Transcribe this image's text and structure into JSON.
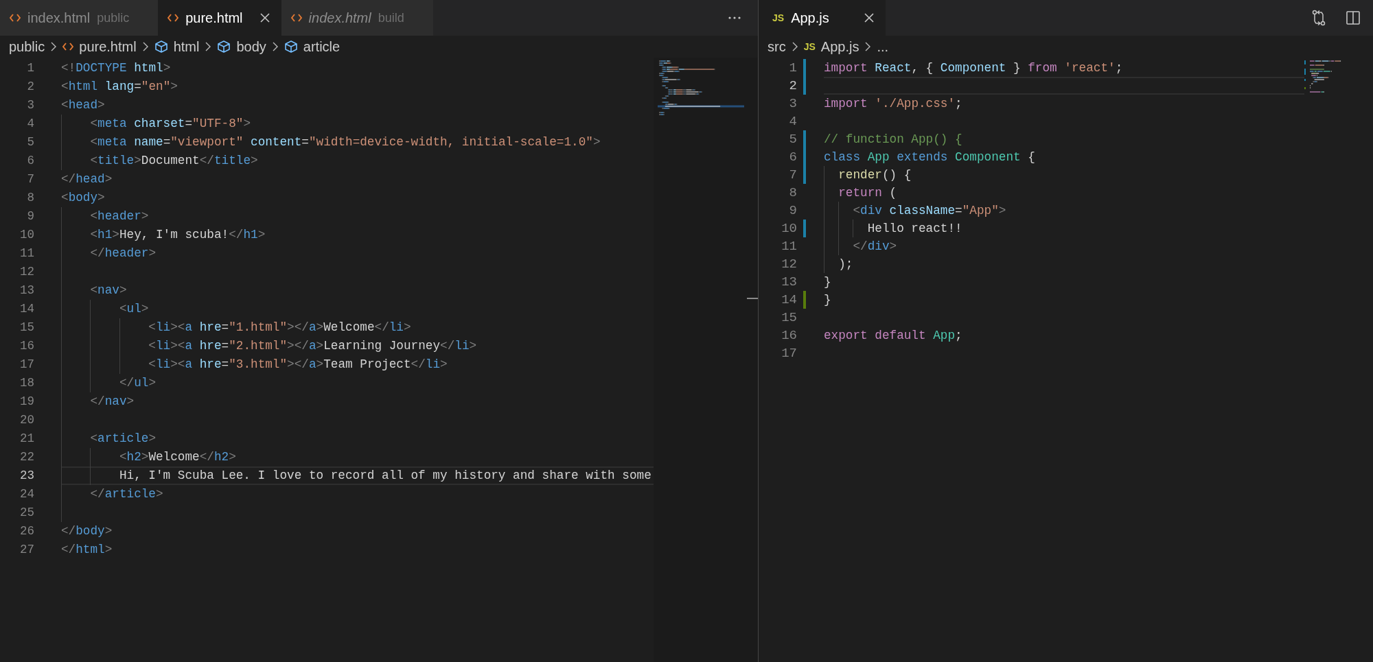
{
  "editors": [
    {
      "tabs": [
        {
          "kind": "html",
          "label": "index.html",
          "description": "public",
          "selected": false,
          "preview": false
        },
        {
          "kind": "html",
          "label": "pure.html",
          "selected": true,
          "preview": false
        },
        {
          "kind": "html",
          "label": "index.html",
          "description": "build",
          "selected": false,
          "preview": true
        }
      ],
      "breadcrumbs": [
        {
          "kind": "folder",
          "label": "public"
        },
        {
          "kind": "html",
          "label": "pure.html"
        },
        {
          "kind": "element",
          "label": "html"
        },
        {
          "kind": "element",
          "label": "body"
        },
        {
          "kind": "element",
          "label": "article"
        }
      ],
      "lines": [
        {
          "number": "1",
          "current": false,
          "tokens": [
            {
              "kind": "punct",
              "text": "<!"
            },
            {
              "kind": "tag",
              "text": "DOCTYPE"
            },
            {
              "kind": "attr",
              "text": " html"
            },
            {
              "kind": "punct",
              "text": ">"
            }
          ]
        },
        {
          "number": "2",
          "current": false,
          "tokens": [
            {
              "kind": "punct",
              "text": "<"
            },
            {
              "kind": "tag",
              "text": "html"
            },
            {
              "kind": "attr",
              "text": " lang"
            },
            {
              "kind": "text",
              "text": "="
            },
            {
              "kind": "string",
              "text": "\"en\""
            },
            {
              "kind": "punct",
              "text": ">"
            }
          ]
        },
        {
          "number": "3",
          "current": false,
          "tokens": [
            {
              "kind": "punct",
              "text": "<"
            },
            {
              "kind": "tag",
              "text": "head"
            },
            {
              "kind": "punct",
              "text": ">"
            }
          ]
        },
        {
          "number": "4",
          "current": false,
          "tokens": [
            {
              "kind": "punct",
              "text": "    <"
            },
            {
              "kind": "tag",
              "text": "meta"
            },
            {
              "kind": "attr",
              "text": " charset"
            },
            {
              "kind": "text",
              "text": "="
            },
            {
              "kind": "string",
              "text": "\"UTF-8\""
            },
            {
              "kind": "punct",
              "text": ">"
            }
          ]
        },
        {
          "number": "5",
          "current": false,
          "tokens": [
            {
              "kind": "punct",
              "text": "    <"
            },
            {
              "kind": "tag",
              "text": "meta"
            },
            {
              "kind": "attr",
              "text": " name"
            },
            {
              "kind": "text",
              "text": "="
            },
            {
              "kind": "string",
              "text": "\"viewport\""
            },
            {
              "kind": "attr",
              "text": " content"
            },
            {
              "kind": "text",
              "text": "="
            },
            {
              "kind": "string",
              "text": "\"width=device-width, initial-scale=1.0\""
            },
            {
              "kind": "punct",
              "text": ">"
            }
          ]
        },
        {
          "number": "6",
          "current": false,
          "tokens": [
            {
              "kind": "punct",
              "text": "    <"
            },
            {
              "kind": "tag",
              "text": "title"
            },
            {
              "kind": "punct",
              "text": ">"
            },
            {
              "kind": "text",
              "text": "Document"
            },
            {
              "kind": "punct",
              "text": "</"
            },
            {
              "kind": "tag",
              "text": "title"
            },
            {
              "kind": "punct",
              "text": ">"
            }
          ]
        },
        {
          "number": "7",
          "current": false,
          "tokens": [
            {
              "kind": "punct",
              "text": "</"
            },
            {
              "kind": "tag",
              "text": "head"
            },
            {
              "kind": "punct",
              "text": ">"
            }
          ]
        },
        {
          "number": "8",
          "current": false,
          "tokens": [
            {
              "kind": "punct",
              "text": "<"
            },
            {
              "kind": "tag",
              "text": "body"
            },
            {
              "kind": "punct",
              "text": ">"
            }
          ]
        },
        {
          "number": "9",
          "current": false,
          "tokens": [
            {
              "kind": "punct",
              "text": "    <"
            },
            {
              "kind": "tag",
              "text": "header"
            },
            {
              "kind": "punct",
              "text": ">"
            }
          ]
        },
        {
          "number": "10",
          "current": false,
          "tokens": [
            {
              "kind": "punct",
              "text": "    <"
            },
            {
              "kind": "tag",
              "text": "h1"
            },
            {
              "kind": "punct",
              "text": ">"
            },
            {
              "kind": "text",
              "text": "Hey, I'm scuba!"
            },
            {
              "kind": "punct",
              "text": "</"
            },
            {
              "kind": "tag",
              "text": "h1"
            },
            {
              "kind": "punct",
              "text": ">"
            }
          ]
        },
        {
          "number": "11",
          "current": false,
          "tokens": [
            {
              "kind": "punct",
              "text": "    </"
            },
            {
              "kind": "tag",
              "text": "header"
            },
            {
              "kind": "punct",
              "text": ">"
            }
          ]
        },
        {
          "number": "12",
          "current": false
        },
        {
          "number": "13",
          "current": false,
          "tokens": [
            {
              "kind": "punct",
              "text": "    <"
            },
            {
              "kind": "tag",
              "text": "nav"
            },
            {
              "kind": "punct",
              "text": ">"
            }
          ]
        },
        {
          "number": "14",
          "current": false,
          "tokens": [
            {
              "kind": "punct",
              "text": "        <"
            },
            {
              "kind": "tag",
              "text": "ul"
            },
            {
              "kind": "punct",
              "text": ">"
            }
          ]
        },
        {
          "number": "15",
          "current": false,
          "tokens": [
            {
              "kind": "punct",
              "text": "            <"
            },
            {
              "kind": "tag",
              "text": "li"
            },
            {
              "kind": "punct",
              "text": "><"
            },
            {
              "kind": "tag",
              "text": "a"
            },
            {
              "kind": "attr",
              "text": " hre"
            },
            {
              "kind": "text",
              "text": "="
            },
            {
              "kind": "string",
              "text": "\"1.html\""
            },
            {
              "kind": "punct",
              "text": "></"
            },
            {
              "kind": "tag",
              "text": "a"
            },
            {
              "kind": "punct",
              "text": ">"
            },
            {
              "kind": "text",
              "text": "Welcome"
            },
            {
              "kind": "punct",
              "text": "</"
            },
            {
              "kind": "tag",
              "text": "li"
            },
            {
              "kind": "punct",
              "text": ">"
            }
          ]
        },
        {
          "number": "16",
          "current": false,
          "tokens": [
            {
              "kind": "punct",
              "text": "            <"
            },
            {
              "kind": "tag",
              "text": "li"
            },
            {
              "kind": "punct",
              "text": "><"
            },
            {
              "kind": "tag",
              "text": "a"
            },
            {
              "kind": "attr",
              "text": " hre"
            },
            {
              "kind": "text",
              "text": "="
            },
            {
              "kind": "string",
              "text": "\"2.html\""
            },
            {
              "kind": "punct",
              "text": "></"
            },
            {
              "kind": "tag",
              "text": "a"
            },
            {
              "kind": "punct",
              "text": ">"
            },
            {
              "kind": "text",
              "text": "Learning Journey"
            },
            {
              "kind": "punct",
              "text": "</"
            },
            {
              "kind": "tag",
              "text": "li"
            },
            {
              "kind": "punct",
              "text": ">"
            }
          ]
        },
        {
          "number": "17",
          "current": false,
          "tokens": [
            {
              "kind": "punct",
              "text": "            <"
            },
            {
              "kind": "tag",
              "text": "li"
            },
            {
              "kind": "punct",
              "text": "><"
            },
            {
              "kind": "tag",
              "text": "a"
            },
            {
              "kind": "attr",
              "text": " hre"
            },
            {
              "kind": "text",
              "text": "="
            },
            {
              "kind": "string",
              "text": "\"3.html\""
            },
            {
              "kind": "punct",
              "text": "></"
            },
            {
              "kind": "tag",
              "text": "a"
            },
            {
              "kind": "punct",
              "text": ">"
            },
            {
              "kind": "text",
              "text": "Team Project"
            },
            {
              "kind": "punct",
              "text": "</"
            },
            {
              "kind": "tag",
              "text": "li"
            },
            {
              "kind": "punct",
              "text": ">"
            }
          ]
        },
        {
          "number": "18",
          "current": false,
          "tokens": [
            {
              "kind": "punct",
              "text": "        </"
            },
            {
              "kind": "tag",
              "text": "ul"
            },
            {
              "kind": "punct",
              "text": ">"
            }
          ]
        },
        {
          "number": "19",
          "current": false,
          "tokens": [
            {
              "kind": "punct",
              "text": "    </"
            },
            {
              "kind": "tag",
              "text": "nav"
            },
            {
              "kind": "punct",
              "text": ">"
            }
          ]
        },
        {
          "number": "20",
          "current": false
        },
        {
          "number": "21",
          "current": false,
          "tokens": [
            {
              "kind": "punct",
              "text": "    <"
            },
            {
              "kind": "tag",
              "text": "article"
            },
            {
              "kind": "punct",
              "text": ">"
            }
          ]
        },
        {
          "number": "22",
          "current": false,
          "tokens": [
            {
              "kind": "punct",
              "text": "        <"
            },
            {
              "kind": "tag",
              "text": "h2"
            },
            {
              "kind": "punct",
              "text": ">"
            },
            {
              "kind": "text",
              "text": "Welcome"
            },
            {
              "kind": "punct",
              "text": "</"
            },
            {
              "kind": "tag",
              "text": "h2"
            },
            {
              "kind": "punct",
              "text": ">"
            }
          ]
        },
        {
          "number": "23",
          "current": true,
          "tokens": [
            {
              "kind": "text",
              "text": "        Hi, I'm Scuba Lee. I love to record all of my history and share with some"
            }
          ]
        },
        {
          "number": "24",
          "current": false,
          "tokens": [
            {
              "kind": "punct",
              "text": "    </"
            },
            {
              "kind": "tag",
              "text": "article"
            },
            {
              "kind": "punct",
              "text": ">"
            }
          ]
        },
        {
          "number": "25",
          "current": false
        },
        {
          "number": "26",
          "current": false,
          "tokens": [
            {
              "kind": "punct",
              "text": "</"
            },
            {
              "kind": "tag",
              "text": "body"
            },
            {
              "kind": "punct",
              "text": ">"
            }
          ]
        },
        {
          "number": "27",
          "current": false,
          "tokens": [
            {
              "kind": "punct",
              "text": "</"
            },
            {
              "kind": "tag",
              "text": "html"
            },
            {
              "kind": "punct",
              "text": ">"
            }
          ]
        }
      ]
    },
    {
      "tabs": [
        {
          "kind": "js",
          "badge": "JS",
          "label": "App.js",
          "selected": true,
          "preview": false
        }
      ],
      "breadcrumbs": [
        {
          "kind": "folder",
          "label": "src"
        },
        {
          "kind": "js",
          "badge": "JS",
          "label": "App.js"
        },
        {
          "kind": "more",
          "label": "..."
        }
      ],
      "lines": [
        {
          "number": "1",
          "current": false,
          "color": "#1b81a8",
          "tokens": [
            {
              "kind": "keyword",
              "text": "import "
            },
            {
              "kind": "variable",
              "text": "React"
            },
            {
              "kind": "text",
              "text": ", { "
            },
            {
              "kind": "variable",
              "text": "Component"
            },
            {
              "kind": "text",
              "text": " } "
            },
            {
              "kind": "keyword",
              "text": "from "
            },
            {
              "kind": "string",
              "text": "'react'"
            },
            {
              "kind": "text",
              "text": ";"
            }
          ]
        },
        {
          "number": "2",
          "current": true,
          "color": "#1b81a8"
        },
        {
          "number": "3",
          "current": false,
          "tokens": [
            {
              "kind": "keyword",
              "text": "import "
            },
            {
              "kind": "string",
              "text": "'./App.css'"
            },
            {
              "kind": "text",
              "text": ";"
            }
          ]
        },
        {
          "number": "4",
          "current": false
        },
        {
          "number": "5",
          "current": false,
          "color": "#1b81a8",
          "tokens": [
            {
              "kind": "comment",
              "text": "// function App() {"
            }
          ]
        },
        {
          "number": "6",
          "current": false,
          "color": "#1b81a8",
          "tokens": [
            {
              "kind": "storage",
              "text": "class "
            },
            {
              "kind": "class",
              "text": "App "
            },
            {
              "kind": "storage",
              "text": "extends "
            },
            {
              "kind": "class",
              "text": "Component"
            },
            {
              "kind": "text",
              "text": " {"
            }
          ]
        },
        {
          "number": "7",
          "current": false,
          "color": "#1b81a8",
          "tokens": [
            {
              "kind": "function",
              "text": "  render"
            },
            {
              "kind": "text",
              "text": "() {"
            }
          ]
        },
        {
          "number": "8",
          "current": false,
          "tokens": [
            {
              "kind": "keyword",
              "text": "  return"
            },
            {
              "kind": "text",
              "text": " ("
            }
          ]
        },
        {
          "number": "9",
          "current": false,
          "tokens": [
            {
              "kind": "punct",
              "text": "    <"
            },
            {
              "kind": "tag",
              "text": "div"
            },
            {
              "kind": "attr",
              "text": " className"
            },
            {
              "kind": "text",
              "text": "="
            },
            {
              "kind": "string",
              "text": "\"App\""
            },
            {
              "kind": "punct",
              "text": ">"
            }
          ]
        },
        {
          "number": "10",
          "current": false,
          "color": "#1b81a8",
          "tokens": [
            {
              "kind": "text",
              "text": "      Hello react!!"
            }
          ]
        },
        {
          "number": "11",
          "current": false,
          "tokens": [
            {
              "kind": "punct",
              "text": "    </"
            },
            {
              "kind": "tag",
              "text": "div"
            },
            {
              "kind": "punct",
              "text": ">"
            }
          ]
        },
        {
          "number": "12",
          "current": false,
          "tokens": [
            {
              "kind": "text",
              "text": "  );"
            }
          ]
        },
        {
          "number": "13",
          "current": false,
          "tokens": [
            {
              "kind": "text",
              "text": "}"
            }
          ]
        },
        {
          "number": "14",
          "current": false,
          "color": "#587c0c",
          "tokens": [
            {
              "kind": "text",
              "text": "}"
            }
          ]
        },
        {
          "number": "15",
          "current": false
        },
        {
          "number": "16",
          "current": false,
          "tokens": [
            {
              "kind": "keyword",
              "text": "export default "
            },
            {
              "kind": "class",
              "text": "App"
            },
            {
              "kind": "text",
              "text": ";"
            }
          ]
        },
        {
          "number": "17",
          "current": false
        }
      ]
    }
  ]
}
